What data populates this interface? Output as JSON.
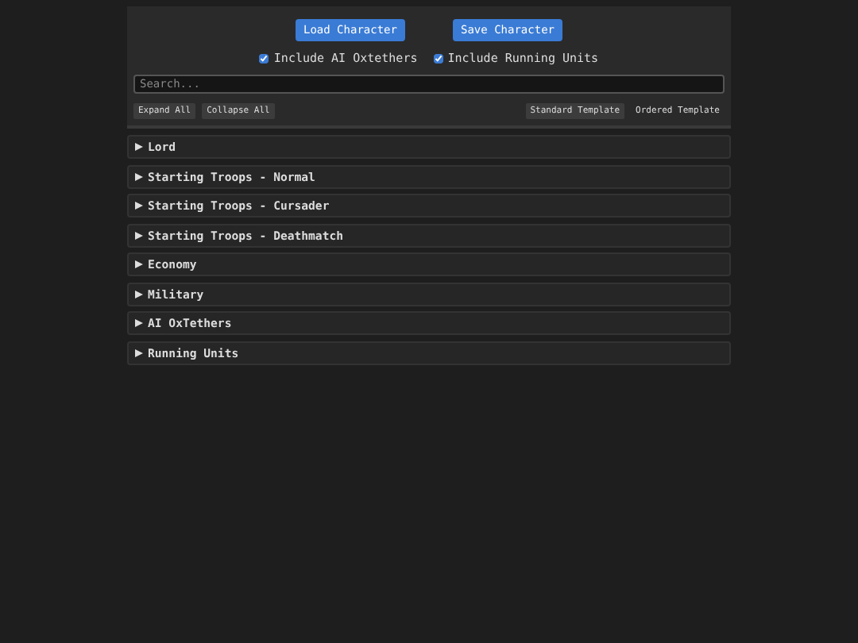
{
  "buttons": [
    "Load Character",
    "Save Character"
  ],
  "options": [
    {
      "label": "Include AI Oxtethers",
      "checked": true
    },
    {
      "label": "Include Running Units",
      "checked": true
    }
  ],
  "search": {
    "placeholder": "Search..."
  },
  "toolbar_buttons": [
    "Expand All",
    "Collapse All"
  ],
  "templates": [
    {
      "label": "Standard Template",
      "selected": true
    },
    {
      "label": "Ordered Template",
      "selected": false
    }
  ],
  "sections": [
    {
      "title": "Lord",
      "expanded": false
    },
    {
      "title": "Starting Troops - Normal",
      "expanded": false
    },
    {
      "title": "Starting Troops - Cursader",
      "expanded": false
    },
    {
      "title": "Starting Troops - Deathmatch",
      "expanded": false
    },
    {
      "title": "Economy",
      "expanded": false
    },
    {
      "title": "Military",
      "expanded": false
    },
    {
      "title": "AI OxTethers",
      "expanded": false
    },
    {
      "title": "Running Units",
      "expanded": false
    }
  ]
}
